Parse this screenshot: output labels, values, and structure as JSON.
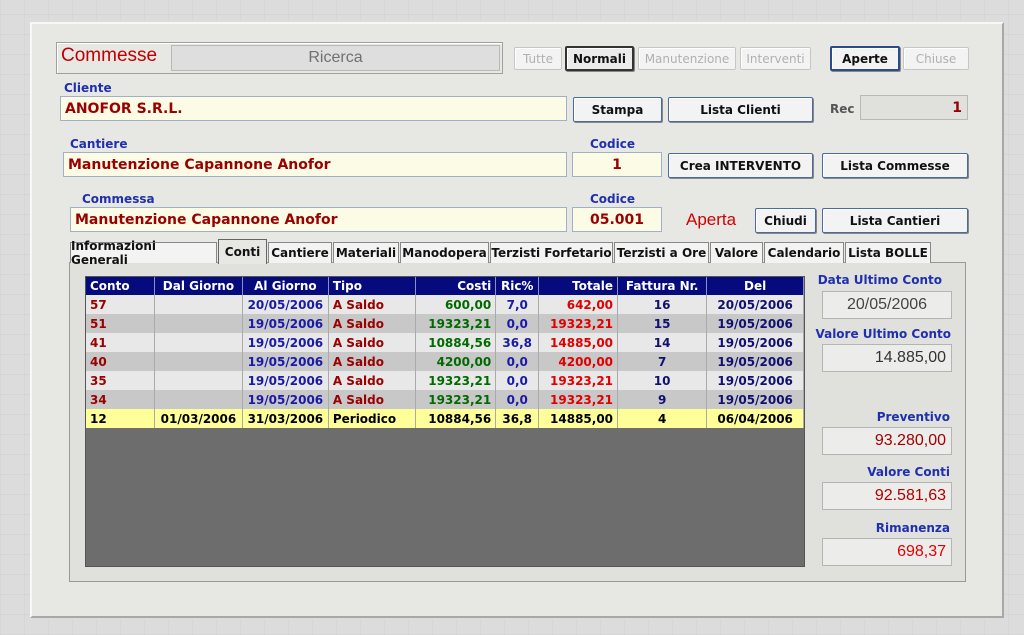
{
  "header": {
    "title": "Commesse",
    "search_label": "Ricerca",
    "filters": [
      {
        "label": "Tutte",
        "state": "disabled"
      },
      {
        "label": "Normali",
        "state": "selected"
      },
      {
        "label": "Manutenzione",
        "state": "disabled"
      },
      {
        "label": "Interventi",
        "state": "disabled"
      },
      {
        "label": "Aperte",
        "state": "selected"
      },
      {
        "label": "Chiuse",
        "state": "disabled"
      }
    ]
  },
  "cliente": {
    "label": "Cliente",
    "value": "ANOFOR S.R.L.",
    "stampa_button": "Stampa",
    "lista_clienti_button": "Lista Clienti",
    "rec_label": "Rec",
    "rec_value": "1"
  },
  "cantiere": {
    "label": "Cantiere",
    "value": "Manutenzione Capannone Anofor",
    "codice_label": "Codice",
    "codice_value": "1",
    "crea_intervento_button": "Crea INTERVENTO",
    "lista_commesse_button": "Lista Commesse"
  },
  "commessa": {
    "label": "Commessa",
    "value": "Manutenzione Capannone Anofor",
    "codice_label": "Codice",
    "codice_value": "05.001",
    "status": "Aperta",
    "chiudi_button": "Chiudi",
    "lista_cantieri_button": "Lista Cantieri"
  },
  "tabs": [
    {
      "label": "Informazioni Generali"
    },
    {
      "label": "Conti",
      "active": true
    },
    {
      "label": "Cantiere"
    },
    {
      "label": "Materiali"
    },
    {
      "label": "Manodopera"
    },
    {
      "label": "Terzisti Forfetario"
    },
    {
      "label": "Terzisti a Ore"
    },
    {
      "label": "Valore"
    },
    {
      "label": "Calendario"
    },
    {
      "label": "Lista BOLLE"
    }
  ],
  "conti_table": {
    "columns": [
      "Conto",
      "Dal Giorno",
      "Al Giorno",
      "Tipo",
      "Costi",
      "Ric%",
      "Totale",
      "Fattura Nr.",
      "Del"
    ],
    "rows": [
      {
        "conto": "57",
        "dal": "",
        "al": "20/05/2006",
        "tipo": "A Saldo",
        "costi": "600,00",
        "ric": "7,0",
        "totale": "642,00",
        "fattura": "16",
        "del": "20/05/2006"
      },
      {
        "conto": "51",
        "dal": "",
        "al": "19/05/2006",
        "tipo": "A Saldo",
        "costi": "19323,21",
        "ric": "0,0",
        "totale": "19323,21",
        "fattura": "15",
        "del": "19/05/2006"
      },
      {
        "conto": "41",
        "dal": "",
        "al": "19/05/2006",
        "tipo": "A Saldo",
        "costi": "10884,56",
        "ric": "36,8",
        "totale": "14885,00",
        "fattura": "14",
        "del": "19/05/2006"
      },
      {
        "conto": "40",
        "dal": "",
        "al": "19/05/2006",
        "tipo": "A Saldo",
        "costi": "4200,00",
        "ric": "0,0",
        "totale": "4200,00",
        "fattura": "7",
        "del": "19/05/2006"
      },
      {
        "conto": "35",
        "dal": "",
        "al": "19/05/2006",
        "tipo": "A Saldo",
        "costi": "19323,21",
        "ric": "0,0",
        "totale": "19323,21",
        "fattura": "10",
        "del": "19/05/2006"
      },
      {
        "conto": "34",
        "dal": "",
        "al": "19/05/2006",
        "tipo": "A Saldo",
        "costi": "19323,21",
        "ric": "0,0",
        "totale": "19323,21",
        "fattura": "9",
        "del": "19/05/2006"
      },
      {
        "conto": "12",
        "dal": "01/03/2006",
        "al": "31/03/2006",
        "tipo": "Periodico",
        "costi": "10884,56",
        "ric": "36,8",
        "totale": "14885,00",
        "fattura": "4",
        "del": "06/04/2006",
        "selected": true
      }
    ]
  },
  "summary": {
    "data_ultimo_conto_label": "Data Ultimo Conto",
    "data_ultimo_conto_value": "20/05/2006",
    "valore_ultimo_conto_label": "Valore Ultimo Conto",
    "valore_ultimo_conto_value": "14.885,00",
    "preventivo_label": "Preventivo",
    "preventivo_value": "93.280,00",
    "valore_conti_label": "Valore Conti",
    "valore_conti_value": "92.581,63",
    "rimanenza_label": "Rimanenza",
    "rimanenza_value": "698,37"
  },
  "colors": {
    "title_red": "#c00000",
    "label_blue": "#1f2fae",
    "table_header": "#050a7c",
    "selected_row": "#ffff99",
    "field_bg": "#fbfbe6"
  }
}
